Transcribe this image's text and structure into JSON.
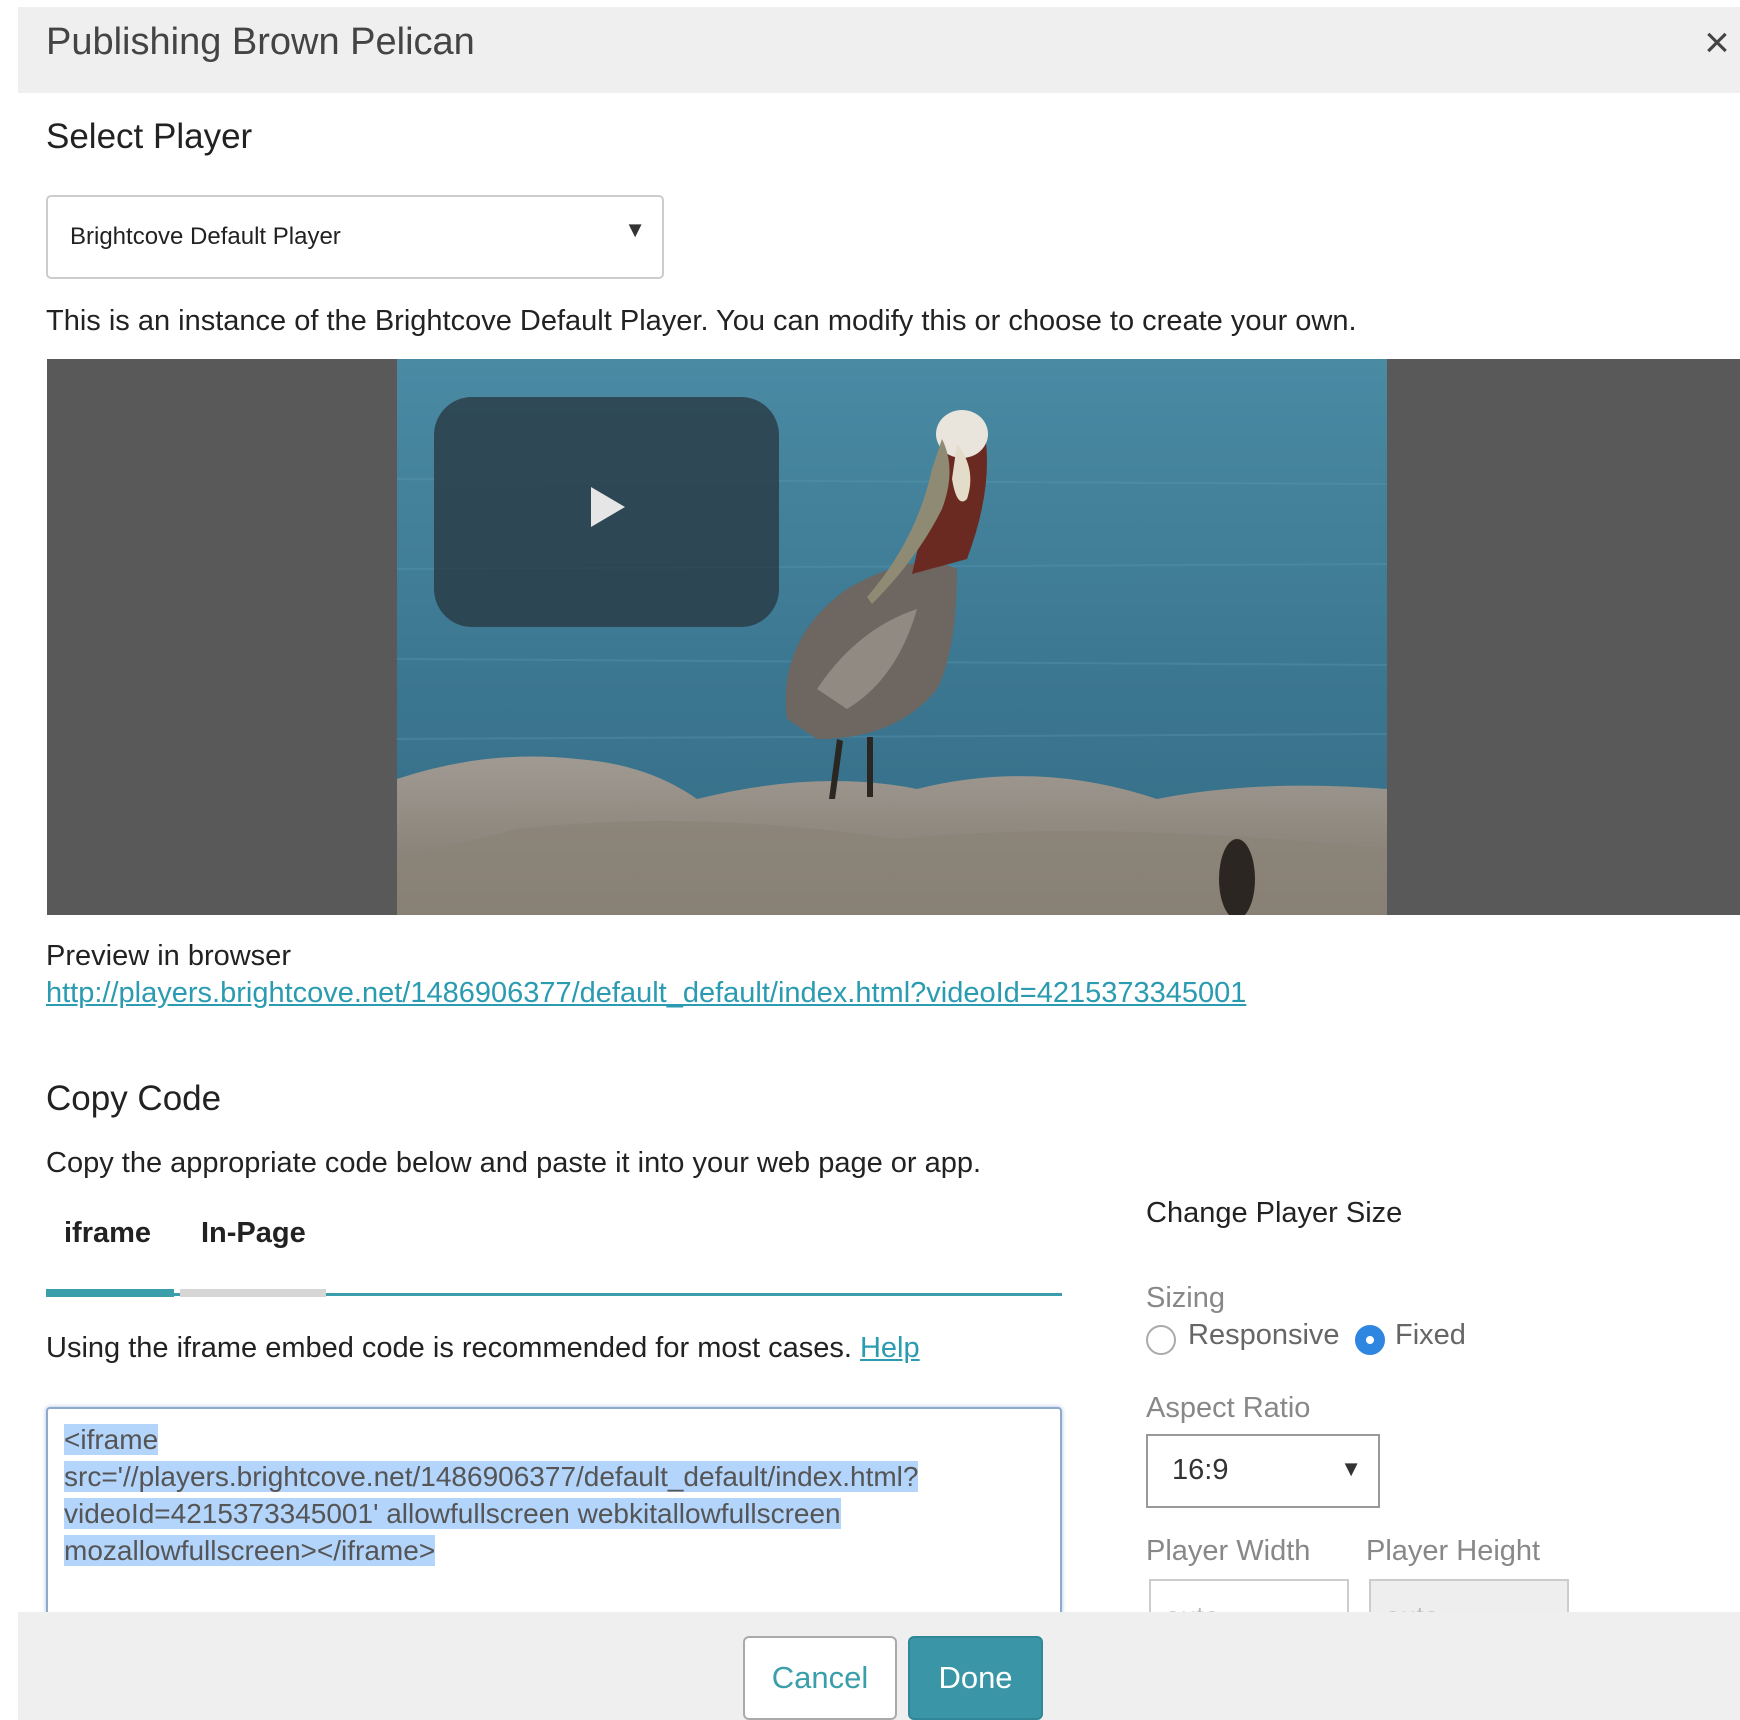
{
  "dialog": {
    "title": "Publishing Brown Pelican",
    "close_icon": "×"
  },
  "select_player": {
    "heading": "Select Player",
    "selected": "Brightcove Default Player",
    "caret": "▼",
    "description": "This is an instance of the Brightcove Default Player. You can modify this or choose to create your own."
  },
  "player": {
    "subject": "brown pelican on rocks",
    "play_icon": "play-icon"
  },
  "preview": {
    "label": "Preview in browser",
    "url": "http://players.brightcove.net/1486906377/default_default/index.html?videoId=4215373345001"
  },
  "copy_code": {
    "heading": "Copy Code",
    "description": "Copy the appropriate code below and paste it into your web page or app.",
    "tabs": [
      {
        "label": "iframe",
        "active": true
      },
      {
        "label": "In-Page",
        "active": false
      }
    ],
    "hint": "Using the iframe embed code is recommended for most cases.",
    "help_link": "Help",
    "code_lines": [
      "<iframe",
      "src='//players.brightcove.net/1486906377/default_default/index.html?",
      "videoId=4215373345001' allowfullscreen webkitallowfullscreen",
      "mozallowfullscreen></iframe>"
    ]
  },
  "player_size": {
    "heading": "Change Player Size",
    "sizing_label": "Sizing",
    "sizing_options": [
      {
        "label": "Responsive",
        "checked": false
      },
      {
        "label": "Fixed",
        "checked": true
      }
    ],
    "aspect_label": "Aspect Ratio",
    "aspect_value": "16:9",
    "width_label": "Player Width",
    "height_label": "Player Height",
    "width_placeholder": "auto",
    "height_placeholder": "auto"
  },
  "footer": {
    "cancel": "Cancel",
    "done": "Done"
  },
  "colors": {
    "accent": "#3a96a6",
    "link": "#2a9bb0",
    "radio_checked": "#2f86e0",
    "selection": "#b3d4fb"
  }
}
